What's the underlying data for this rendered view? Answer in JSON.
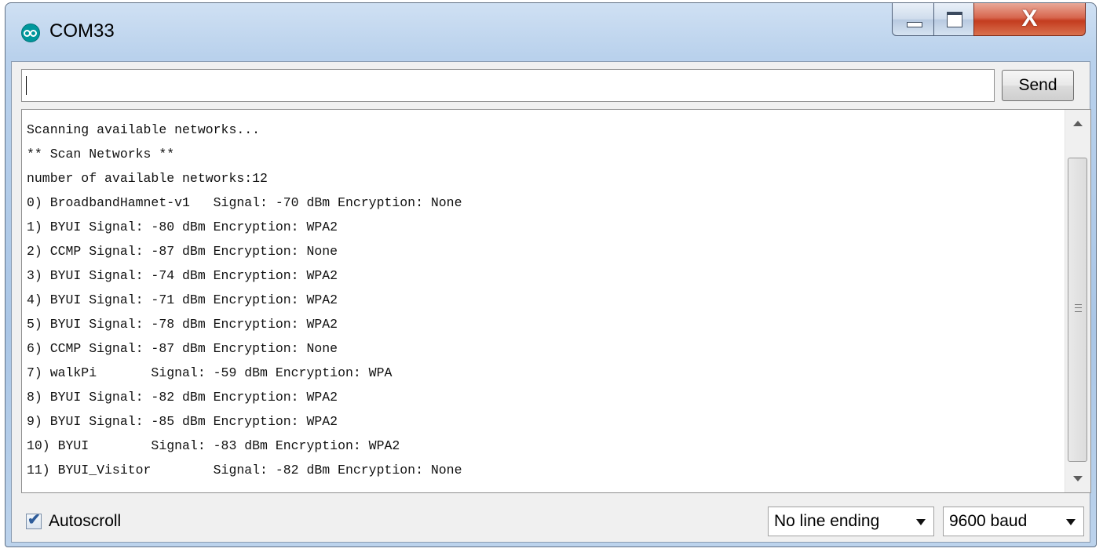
{
  "window": {
    "title": "COM33",
    "close_glyph": "X"
  },
  "send_bar": {
    "input_value": "",
    "send_label": "Send"
  },
  "output": {
    "lines": [
      "Scanning available networks...",
      "** Scan Networks **",
      "number of available networks:12",
      "0) BroadbandHamnet-v1   Signal: -70 dBm Encryption: None",
      "1) BYUI Signal: -80 dBm Encryption: WPA2",
      "2) CCMP Signal: -87 dBm Encryption: None",
      "3) BYUI Signal: -74 dBm Encryption: WPA2",
      "4) BYUI Signal: -71 dBm Encryption: WPA2",
      "5) BYUI Signal: -78 dBm Encryption: WPA2",
      "6) CCMP Signal: -87 dBm Encryption: None",
      "7) walkPi       Signal: -59 dBm Encryption: WPA",
      "8) BYUI Signal: -82 dBm Encryption: WPA2",
      "9) BYUI Signal: -85 dBm Encryption: WPA2",
      "10) BYUI        Signal: -83 dBm Encryption: WPA2",
      "11) BYUI_Visitor        Signal: -82 dBm Encryption: None"
    ]
  },
  "footer": {
    "autoscroll_label": "Autoscroll",
    "autoscroll_checked": true,
    "line_ending": "No line ending",
    "baud": "9600 baud"
  },
  "colors": {
    "arduino_teal": "#00979c",
    "close_red": "#c43c1f"
  },
  "icons": [
    "arduino-logo-icon",
    "minimize-icon",
    "maximize-icon",
    "close-icon",
    "check-icon",
    "chevron-down-icon",
    "scroll-up-icon",
    "scroll-down-icon"
  ]
}
